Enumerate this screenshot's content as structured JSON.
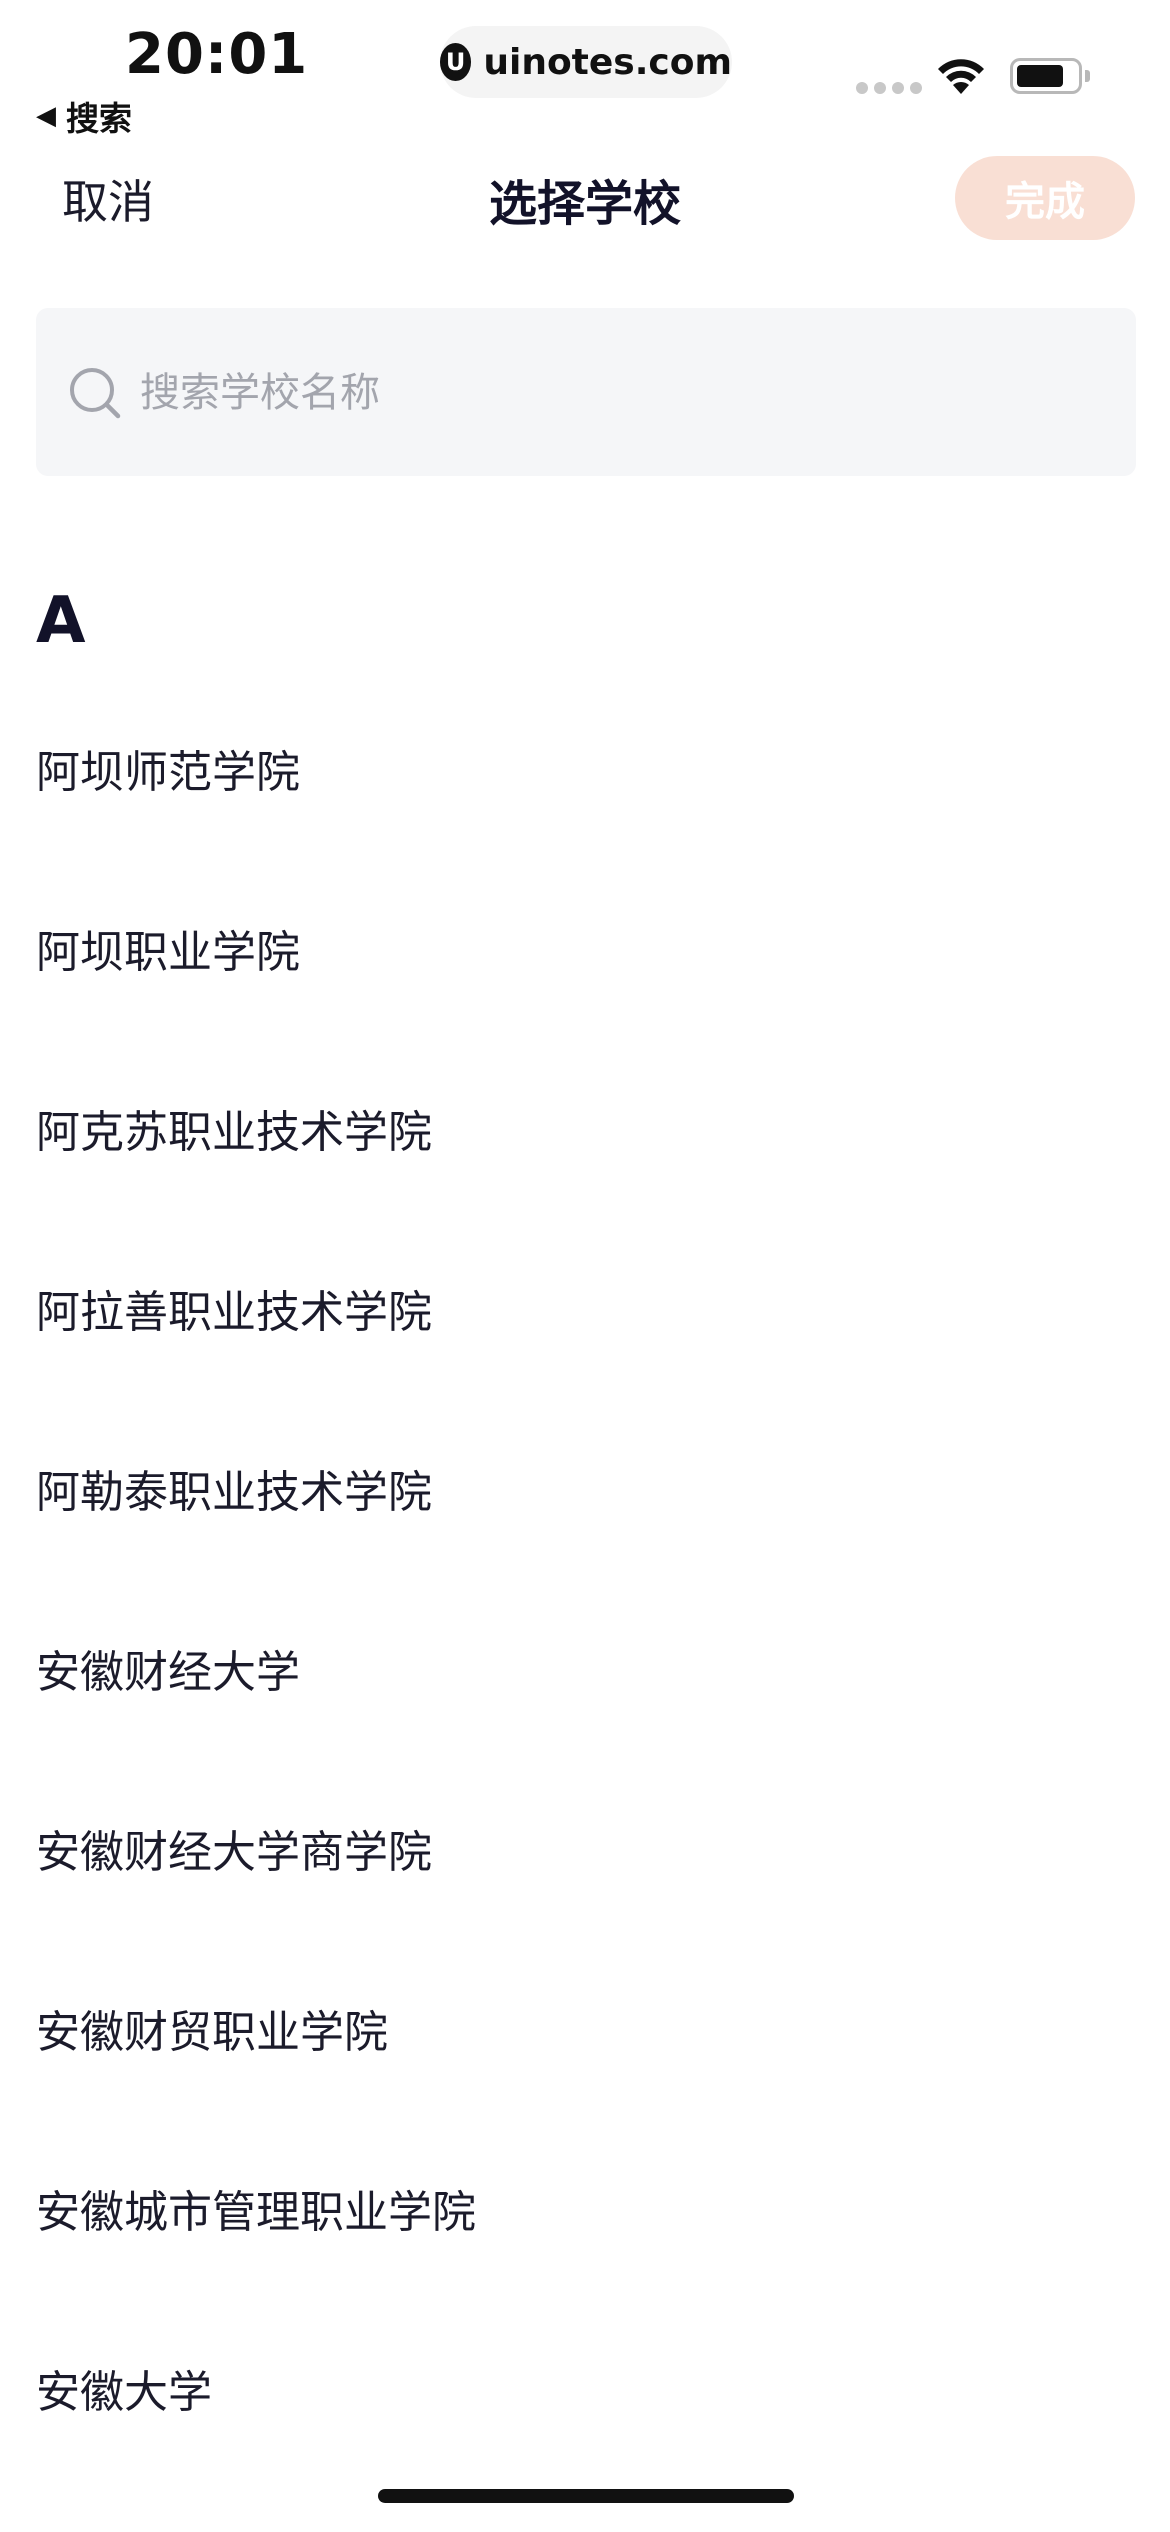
{
  "status_bar": {
    "time": "20:01",
    "back_label": "搜索",
    "url": "uinotes.com",
    "url_logo_letter": "U",
    "battery_level": 0.8
  },
  "nav": {
    "cancel_label": "取消",
    "title": "选择学校",
    "done_label": "完成"
  },
  "search": {
    "placeholder": "搜索学校名称",
    "value": ""
  },
  "section": {
    "letter": "A"
  },
  "schools": [
    "阿坝师范学院",
    "阿坝职业学院",
    "阿克苏职业技术学院",
    "阿拉善职业技术学院",
    "阿勒泰职业技术学院",
    "安徽财经大学",
    "安徽财经大学商学院",
    "安徽财贸职业学院",
    "安徽城市管理职业学院",
    "安徽大学"
  ],
  "colors": {
    "accent_disabled": "#f9dfd4",
    "search_bg": "#f5f6f8",
    "placeholder": "#a3a5ad",
    "text_primary": "#1b1b2b"
  }
}
